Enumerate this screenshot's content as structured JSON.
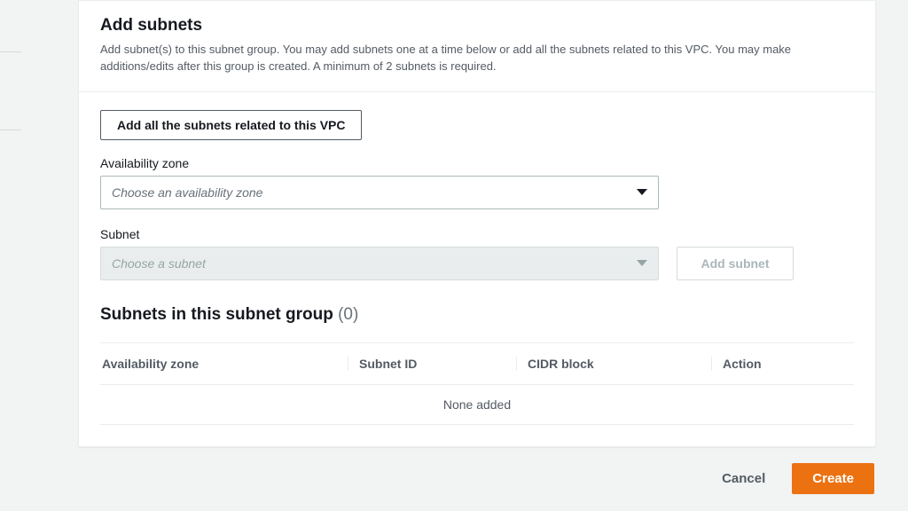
{
  "header": {
    "title": "Add subnets",
    "description": "Add subnet(s) to this subnet group. You may add subnets one at a time below or add all the subnets related to this VPC. You may make additions/edits after this group is created. A minimum of 2 subnets is required."
  },
  "actions": {
    "add_all_label": "Add all the subnets related to this VPC",
    "add_subnet_label": "Add subnet"
  },
  "fields": {
    "availability_zone": {
      "label": "Availability zone",
      "placeholder": "Choose an availability zone"
    },
    "subnet": {
      "label": "Subnet",
      "placeholder": "Choose a subnet"
    }
  },
  "subnet_group": {
    "heading": "Subnets in this subnet group",
    "count_display": "(0)",
    "columns": {
      "availability_zone": "Availability zone",
      "subnet_id": "Subnet ID",
      "cidr_block": "CIDR block",
      "action": "Action"
    },
    "empty": "None added"
  },
  "footer": {
    "cancel": "Cancel",
    "create": "Create"
  }
}
